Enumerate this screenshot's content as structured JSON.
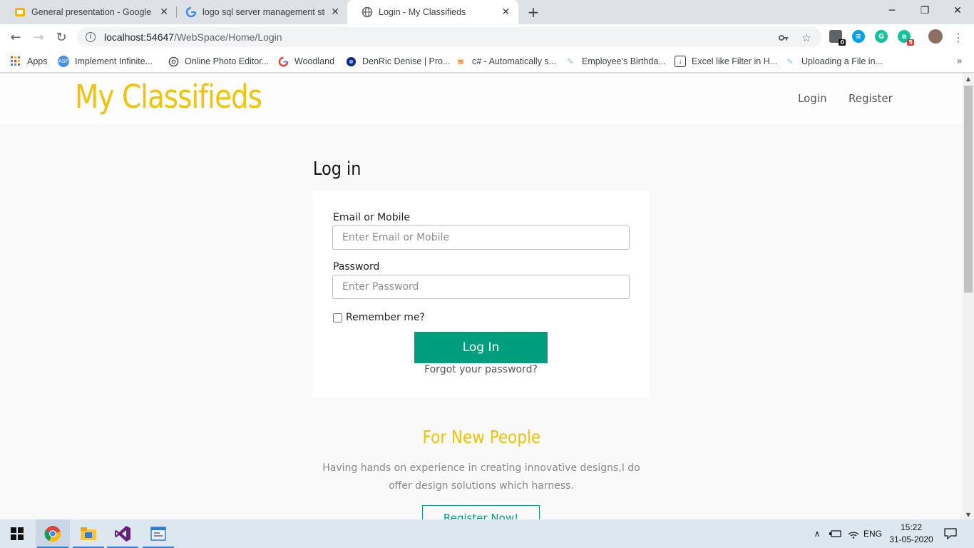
{
  "browser": {
    "tabs": [
      {
        "title": "General presentation - Google Sli",
        "favicon": "slides-icon",
        "active": false
      },
      {
        "title": "logo sql server management studi",
        "favicon": "google-icon",
        "active": false
      },
      {
        "title": "Login - My Classifieds",
        "favicon": "globe-icon",
        "active": true
      }
    ],
    "url_host": "localhost:54647",
    "url_path": "/WebSpace/Home/Login",
    "extension_badges": {
      "first": "0",
      "second": "5"
    },
    "bookmarks": [
      {
        "label": "Apps",
        "icon": "apps-grid-icon"
      },
      {
        "label": "Implement Infinite...",
        "icon": "asp-icon"
      },
      {
        "label": "Online Photo Editor...",
        "icon": "aperture-icon"
      },
      {
        "label": "Woodland",
        "icon": "google-icon"
      },
      {
        "label": "DenRic Denise | Pro...",
        "icon": "eye-icon"
      },
      {
        "label": "c# - Automatically s...",
        "icon": "stackoverflow-icon"
      },
      {
        "label": "Employee's Birthda...",
        "icon": "blog-icon"
      },
      {
        "label": "Excel like Filter in H...",
        "icon": "download-icon"
      },
      {
        "label": "Uploading a File in...",
        "icon": "blog-icon"
      }
    ]
  },
  "site": {
    "brand": "My Classifieds",
    "nav": {
      "login": "Login",
      "register": "Register"
    },
    "login_form": {
      "heading": "Log in",
      "email_label": "Email or Mobile",
      "email_placeholder": "Enter Email or Mobile",
      "password_label": "Password",
      "password_placeholder": "Enter Password",
      "remember_label": "Remember me?",
      "remember_checked": false,
      "submit_label": "Log In",
      "forgot_label": "Forgot your password?"
    },
    "new_people": {
      "heading": "For New People",
      "description": "Having hands on experience in creating innovative designs,I do offer design solutions which harness.",
      "button_label": "Register Now!"
    },
    "colors": {
      "brand": "#f0c20a",
      "accent": "#009d7e"
    }
  },
  "taskbar": {
    "apps": [
      "windows-start-icon",
      "chrome-icon",
      "file-explorer-icon",
      "visual-studio-icon",
      "app-window-icon"
    ],
    "language": "ENG",
    "time": "15:22",
    "date": "31-05-2020"
  }
}
